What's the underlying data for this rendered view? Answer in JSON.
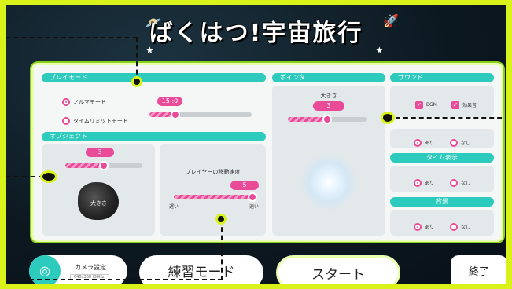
{
  "title": "ばくはつ!宇宙旅行",
  "sections": {
    "play_mode": {
      "header": "プレイモード",
      "options": [
        {
          "label": "ノルマモード",
          "selected": true
        },
        {
          "label": "タイムリミットモード",
          "selected": false
        }
      ],
      "time_badge": "15 :0",
      "slider_fraction": 0.25
    },
    "object": {
      "header": "オブジェクト",
      "size_value": "3",
      "size_slider_fraction": 0.5,
      "asteroid_label": "大きさ",
      "speed_title": "プレイヤーの移動速度",
      "speed_value": "5",
      "speed_slider_fraction": 1.0,
      "slow_label": "遅い",
      "fast_label": "速い"
    },
    "pointer": {
      "header": "ポインタ",
      "size_title": "大きさ",
      "size_value": "3",
      "size_slider_fraction": 0.5
    },
    "sound": {
      "header": "サウンド",
      "checkboxes": [
        {
          "label": "BGM",
          "checked": true
        },
        {
          "label": "効果音",
          "checked": true
        }
      ],
      "radio_on": "あり",
      "radio_off": "なし"
    },
    "time_display": {
      "header": "タイム表示",
      "radio_on": "あり",
      "radio_off": "なし"
    },
    "background": {
      "header": "背景",
      "radio_on": "あり",
      "radio_off": "なし"
    }
  },
  "footer": {
    "camera_label": "カメラ設定",
    "camera_sub": "640x360 (30Hz)",
    "practice_label": "練習モード",
    "start_label": "スタート",
    "end_label": "終了"
  },
  "colors": {
    "accent": "#e94b99",
    "header": "#2dcbbd",
    "frame": "#d9f21a"
  }
}
